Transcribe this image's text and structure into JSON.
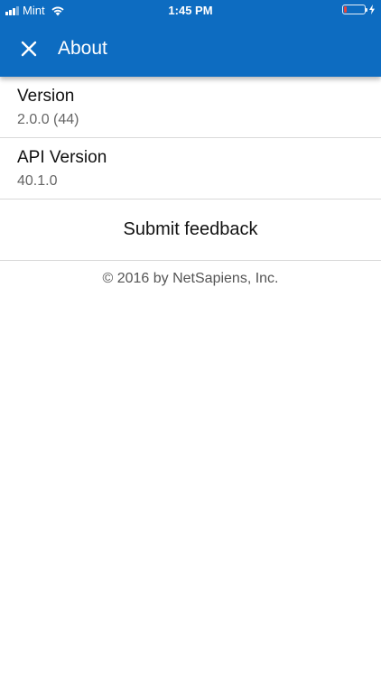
{
  "status_bar": {
    "carrier": "Mint",
    "time": "1:45 PM",
    "battery_level": 0.12
  },
  "app_bar": {
    "title": "About",
    "close_icon": "close-icon"
  },
  "info": [
    {
      "label": "Version",
      "value": "2.0.0 (44)"
    },
    {
      "label": "API Version",
      "value": "40.1.0"
    }
  ],
  "feedback_label": "Submit feedback",
  "copyright": "© 2016 by NetSapiens, Inc.",
  "colors": {
    "primary": "#0d6cc1",
    "battery_low": "#e5443b"
  }
}
